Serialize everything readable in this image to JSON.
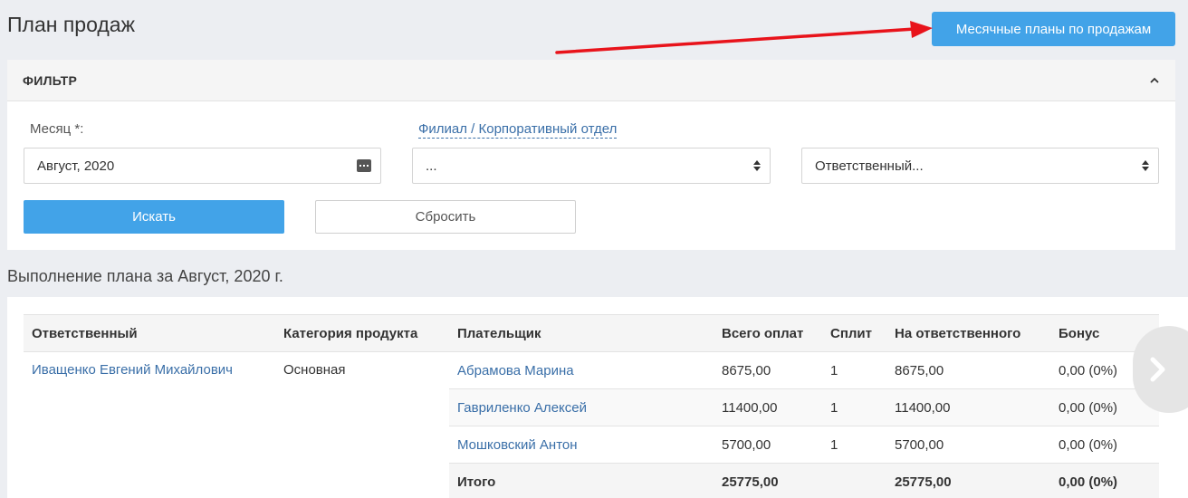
{
  "page": {
    "title": "План продаж",
    "monthly_plans_button": "Месячные планы по продажам"
  },
  "filter": {
    "title": "ФИЛЬТР",
    "month_label": "Месяц *:",
    "branch_label": "Филиал / Корпоративный отдел",
    "month_value": "Август, 2020",
    "branch_value": "...",
    "responsible_value": "Ответственный...",
    "search_button": "Искать",
    "reset_button": "Сбросить"
  },
  "results": {
    "title": "Выполнение плана за Август, 2020 г.",
    "columns": [
      "Ответственный",
      "Категория продукта",
      "Плательщик",
      "Всего оплат",
      "Сплит",
      "На ответственного",
      "Бонус"
    ],
    "responsible": "Иващенко Евгений Михайлович",
    "category": "Основная",
    "rows": [
      {
        "payer": "Абрамова Марина",
        "total": "8675,00",
        "split": "1",
        "on_responsible": "8675,00",
        "bonus": "0,00 (0%)"
      },
      {
        "payer": "Гавриленко Алексей",
        "total": "11400,00",
        "split": "1",
        "on_responsible": "11400,00",
        "bonus": "0,00 (0%)"
      },
      {
        "payer": "Мошковский Антон",
        "total": "5700,00",
        "split": "1",
        "on_responsible": "5700,00",
        "bonus": "0,00 (0%)"
      }
    ],
    "total_row": {
      "label": "Итого",
      "total": "25775,00",
      "on_responsible": "25775,00",
      "bonus": "0,00 (0%)"
    }
  },
  "colors": {
    "primary": "#42a3e8",
    "link": "#3a6fa8",
    "annotation_arrow": "#e8131b"
  },
  "icons": {
    "collapse": "chevron-up-icon",
    "calendar": "calendar-icon",
    "select": "select-arrows-icon",
    "next": "chevron-right-icon"
  }
}
